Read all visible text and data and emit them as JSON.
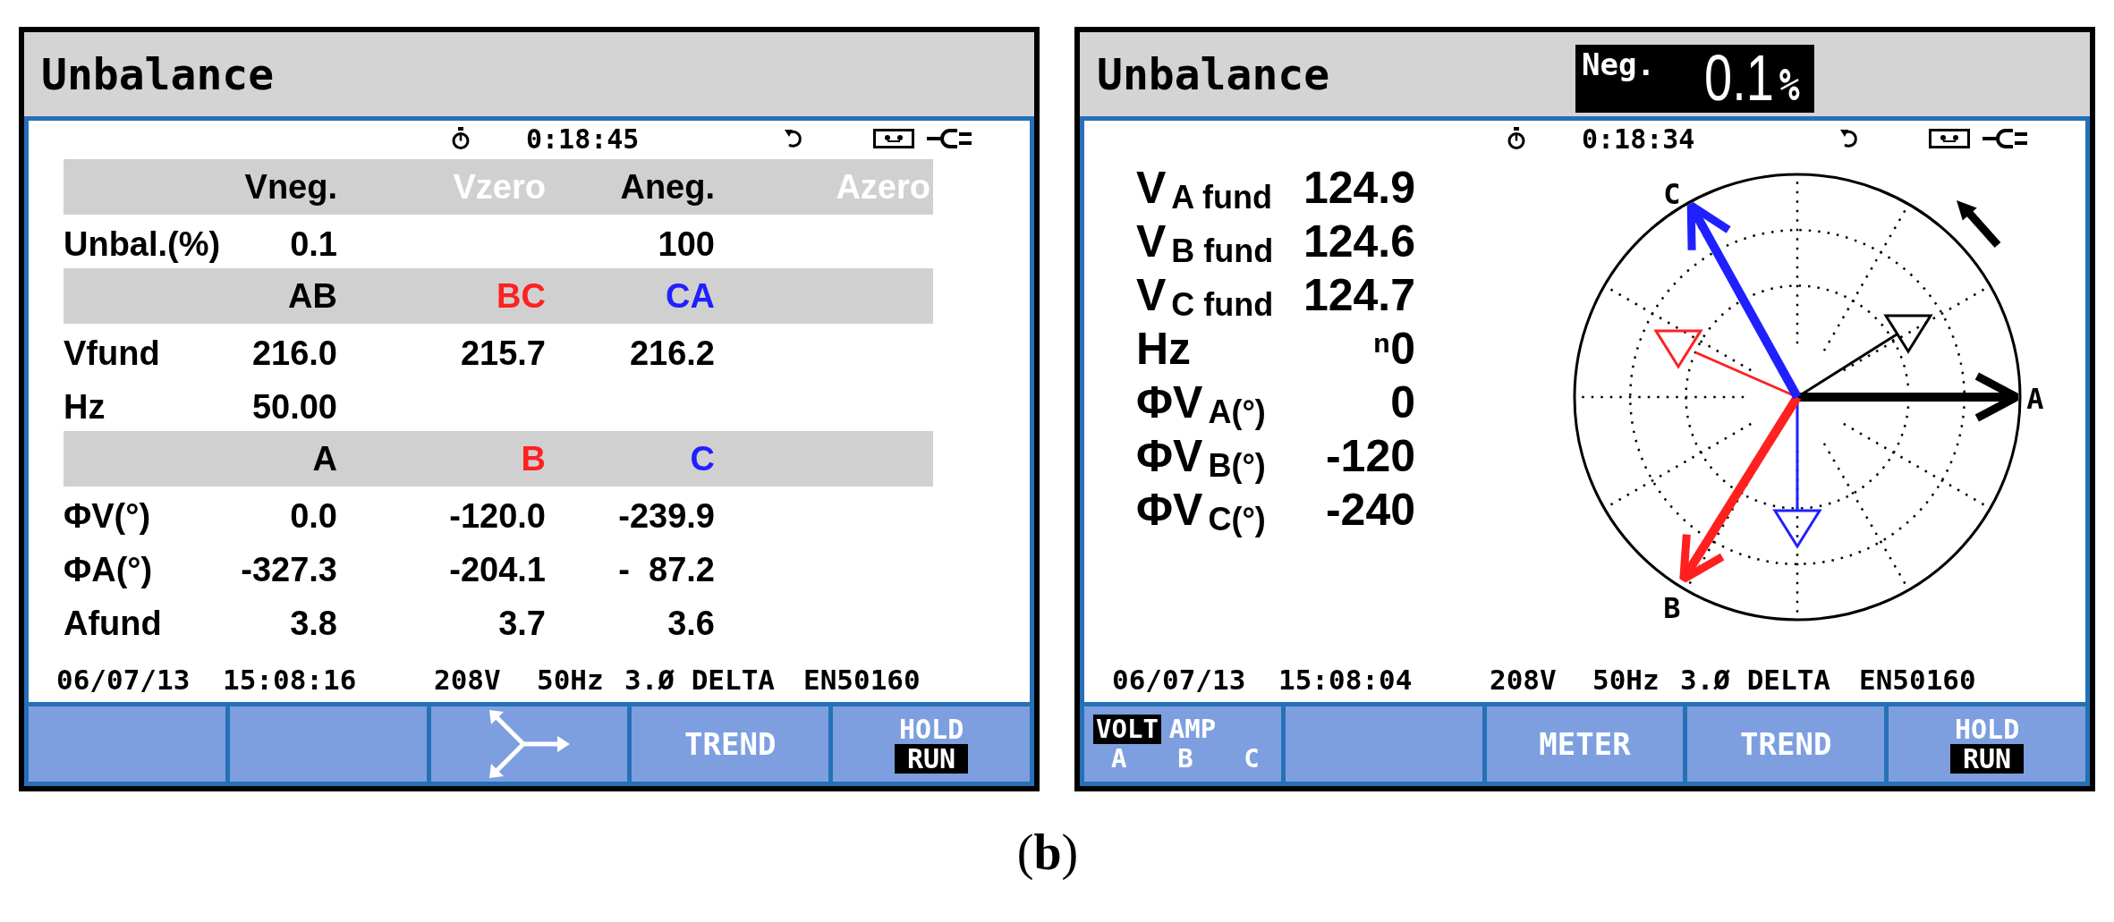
{
  "screens": [
    {
      "kind": "table",
      "title": "Unbalance",
      "timer": "0:18:45",
      "table": {
        "rows": [
          {
            "kind": "band",
            "cells": [
              {
                "text": "Vneg.",
                "disabled": false
              },
              {
                "text": "Vzero",
                "disabled": true
              },
              {
                "text": "Aneg.",
                "disabled": false
              },
              {
                "text": "Azero",
                "disabled": true
              }
            ]
          },
          {
            "kind": "data",
            "label": "Unbal.(%)",
            "values": [
              "0.1",
              "100"
            ]
          },
          {
            "kind": "band",
            "cells": [
              {
                "text": "AB",
                "color": "#000000"
              },
              {
                "text": "BC",
                "color": "#ff2020"
              },
              {
                "text": "CA",
                "color": "#2020ff"
              }
            ]
          },
          {
            "kind": "data",
            "label": "Vfund",
            "values": [
              "216.0",
              "215.7",
              "216.2"
            ]
          },
          {
            "kind": "data",
            "label": "Hz",
            "values": [
              "50.00"
            ]
          },
          {
            "kind": "band",
            "cells": [
              {
                "text": "A",
                "color": "#000000"
              },
              {
                "text": "B",
                "color": "#ff2020"
              },
              {
                "text": "C",
                "color": "#2020ff"
              }
            ]
          },
          {
            "kind": "data",
            "label": "ΦV(°)",
            "values": [
              "0.0",
              "-120.0",
              "-239.9"
            ]
          },
          {
            "kind": "data",
            "label": "ΦA(°)",
            "values": [
              "-327.3",
              "-204.1",
              "-  87.2"
            ]
          },
          {
            "kind": "data",
            "label": "Afund",
            "values": [
              "3.8",
              "3.7",
              "3.6"
            ]
          }
        ]
      },
      "info_line": [
        "06/07/13",
        "15:08:16",
        "208V",
        "50Hz",
        "3.Ø DELTA",
        "EN50160"
      ],
      "softkeys": [
        {
          "kind": "blank"
        },
        {
          "kind": "blank"
        },
        {
          "kind": "icon"
        },
        {
          "kind": "label",
          "label": "TREND"
        },
        {
          "kind": "toggle",
          "options": [
            {
              "label": "HOLD",
              "selected": false
            },
            {
              "label": "RUN",
              "selected": true
            }
          ]
        }
      ]
    },
    {
      "kind": "phasor",
      "title": "Unbalance",
      "badge": {
        "label": "Neg.",
        "value": "0.1",
        "unit": "%"
      },
      "timer": "0:18:34",
      "readings": [
        {
          "label": "V$_{A fund}$",
          "value": "124.9"
        },
        {
          "label": "V$_{B fund}$",
          "value": "124.6"
        },
        {
          "label": "V$_{C fund}$",
          "value": "124.7"
        },
        {
          "label": "Hz",
          "value": "ⁿ0"
        },
        {
          "label": "ΦV$_{A(°)}$",
          "value": "0"
        },
        {
          "label": "ΦV$_{B(°)}$",
          "value": "-120"
        },
        {
          "label": "ΦV$_{C(°)}$",
          "value": "-240"
        }
      ],
      "phasor_diagram": {
        "labels": [
          "C",
          "A",
          "B"
        ]
      },
      "info_line": [
        "06/07/13",
        "15:08:04",
        "208V",
        "50Hz",
        "3.Ø DELTA",
        "EN50160"
      ],
      "softkeys": [
        {
          "kind": "choice",
          "options": [
            {
              "label": "VOLT",
              "selected": true
            },
            {
              "label": "AMP",
              "selected": false
            }
          ],
          "phases": [
            "A",
            "B",
            "C"
          ]
        },
        {
          "kind": "blank"
        },
        {
          "kind": "label",
          "label": "METER"
        },
        {
          "kind": "label",
          "label": "TREND"
        },
        {
          "kind": "toggle",
          "options": [
            {
              "label": "HOLD",
              "selected": false
            },
            {
              "label": "RUN",
              "selected": true
            }
          ]
        }
      ]
    }
  ],
  "caption": "(**b**)"
}
